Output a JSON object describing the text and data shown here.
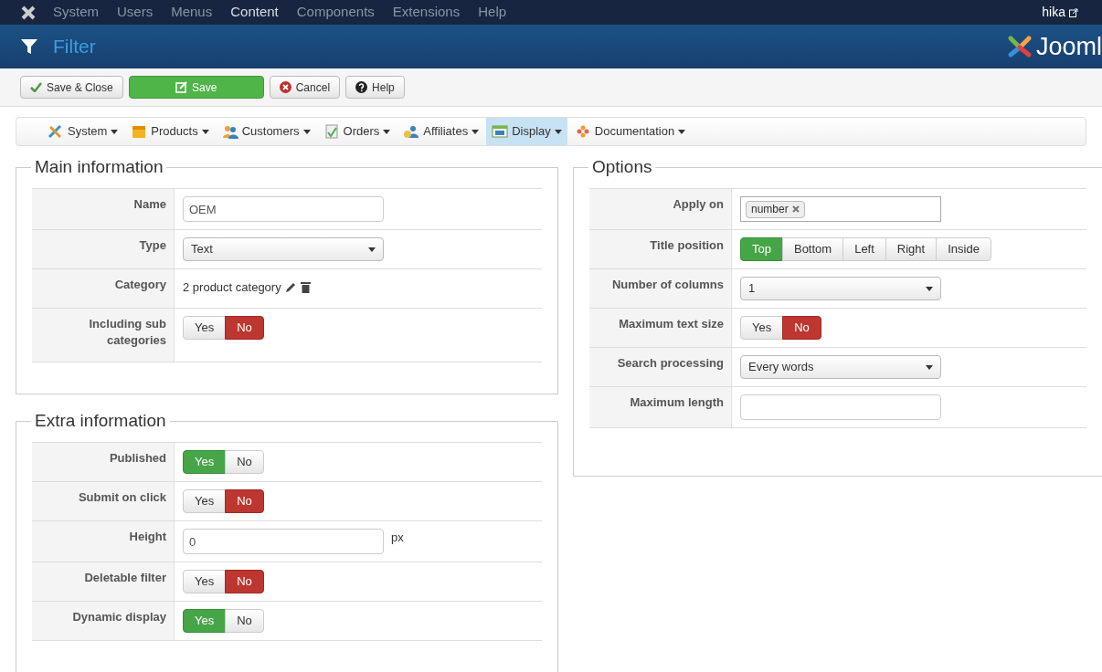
{
  "top_menu": {
    "items": [
      {
        "label": "System",
        "selected": false
      },
      {
        "label": "Users",
        "selected": false
      },
      {
        "label": "Menus",
        "selected": false
      },
      {
        "label": "Content",
        "selected": true
      },
      {
        "label": "Components",
        "selected": false
      },
      {
        "label": "Extensions",
        "selected": false
      },
      {
        "label": "Help",
        "selected": false
      }
    ],
    "user": "hika"
  },
  "header": {
    "title": "Filter",
    "logo_text": "Jooml"
  },
  "toolbar": [
    {
      "label": "Save & Close",
      "kind": "check"
    },
    {
      "label": "Save",
      "kind": "primary"
    },
    {
      "label": "Cancel",
      "kind": "cancel"
    },
    {
      "label": "Help",
      "kind": "help"
    }
  ],
  "submenu": [
    {
      "label": "System",
      "kind": "tools",
      "selected": false
    },
    {
      "label": "Products",
      "kind": "box",
      "selected": false
    },
    {
      "label": "Customers",
      "kind": "users",
      "selected": false
    },
    {
      "label": "Orders",
      "kind": "doc",
      "selected": false
    },
    {
      "label": "Affiliates",
      "kind": "money",
      "selected": false
    },
    {
      "label": "Display",
      "kind": "window",
      "selected": true
    },
    {
      "label": "Documentation",
      "kind": "flower",
      "selected": false
    }
  ],
  "main_information": {
    "title": "Main information",
    "rows": [
      {
        "label": "Name",
        "kind": "text",
        "value": "OEM"
      },
      {
        "label": "Type",
        "kind": "select",
        "value": "Text"
      },
      {
        "label": "Category",
        "kind": "category",
        "value": "2 product category"
      },
      {
        "label": "Including sub categories",
        "kind": "toggle",
        "options": [
          {
            "label": "Yes",
            "selected": false
          },
          {
            "label": "No",
            "selected": true
          }
        ]
      }
    ]
  },
  "extra_information": {
    "title": "Extra information",
    "rows": [
      {
        "label": "Published",
        "kind": "toggle",
        "options": [
          {
            "label": "Yes",
            "selected": true
          },
          {
            "label": "No",
            "selected": false
          }
        ]
      },
      {
        "label": "Submit on click",
        "kind": "toggle",
        "options": [
          {
            "label": "Yes",
            "selected": false
          },
          {
            "label": "No",
            "selected": true
          }
        ]
      },
      {
        "label": "Height",
        "kind": "text",
        "value": "0",
        "unit": "px"
      },
      {
        "label": "Deletable filter",
        "kind": "toggle",
        "options": [
          {
            "label": "Yes",
            "selected": false
          },
          {
            "label": "No",
            "selected": true
          }
        ]
      },
      {
        "label": "Dynamic display",
        "kind": "toggle",
        "options": [
          {
            "label": "Yes",
            "selected": true
          },
          {
            "label": "No",
            "selected": false
          }
        ]
      }
    ]
  },
  "options": {
    "title": "Options",
    "rows": [
      {
        "label": "Apply on",
        "kind": "tags",
        "tags": [
          "number"
        ]
      },
      {
        "label": "Title position",
        "kind": "segmented",
        "options": [
          {
            "label": "Top",
            "selected": true
          },
          {
            "label": "Bottom",
            "selected": false
          },
          {
            "label": "Left",
            "selected": false
          },
          {
            "label": "Right",
            "selected": false
          },
          {
            "label": "Inside",
            "selected": false
          }
        ]
      },
      {
        "label": "Number of columns",
        "kind": "select",
        "value": "1"
      },
      {
        "label": "Maximum text size",
        "kind": "toggle",
        "options": [
          {
            "label": "Yes",
            "selected": false
          },
          {
            "label": "No",
            "selected": true
          }
        ]
      },
      {
        "label": "Search processing",
        "kind": "select",
        "value": "Every words"
      },
      {
        "label": "Maximum length",
        "kind": "text"
      }
    ]
  }
}
